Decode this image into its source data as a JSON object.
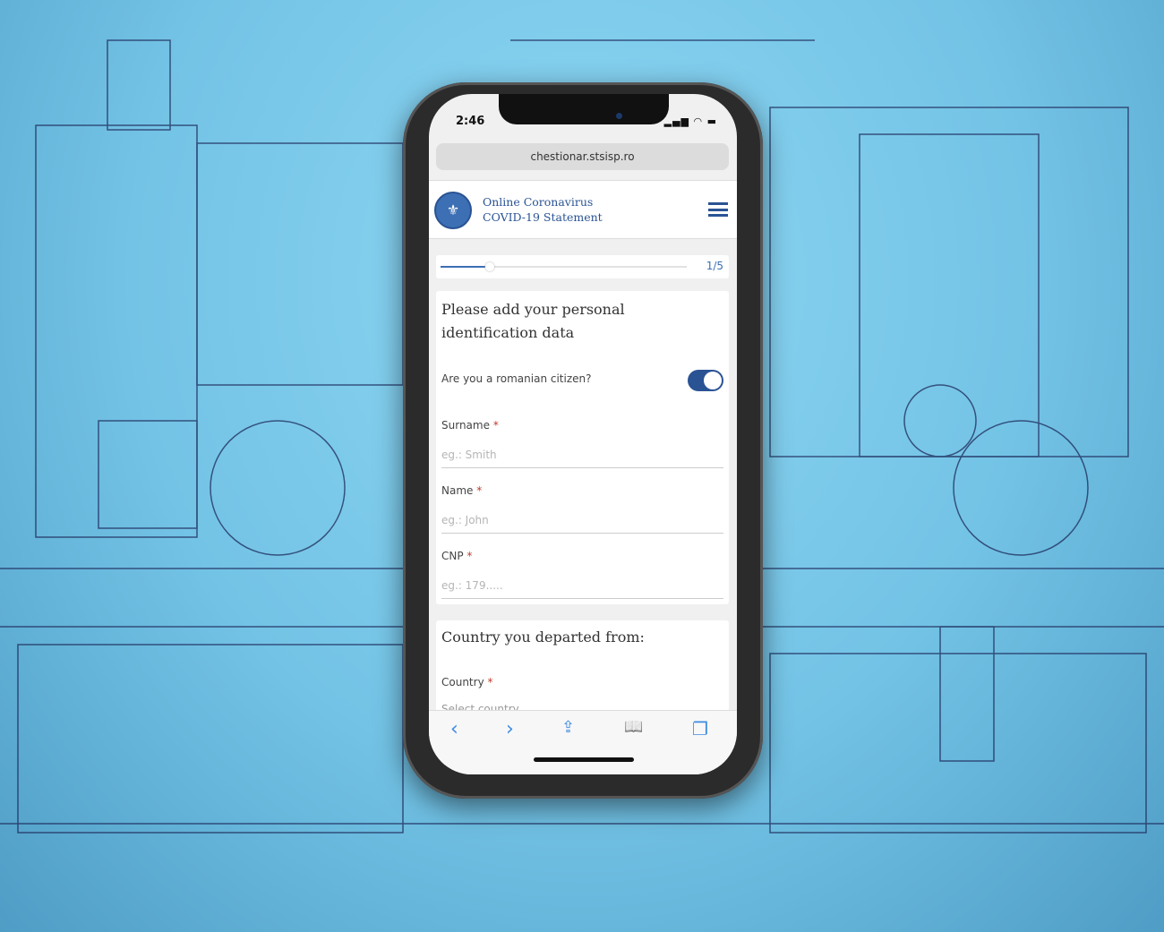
{
  "status_bar": {
    "time": "2:46",
    "icons": "signal wifi battery"
  },
  "browser": {
    "url": "chestionar.stsisp.ro",
    "toolbar": [
      {
        "icon": "back-icon",
        "glyph": "‹"
      },
      {
        "icon": "forward-icon",
        "glyph": "›"
      },
      {
        "icon": "share-icon",
        "glyph": "⇪"
      },
      {
        "icon": "bookmarks-icon",
        "glyph": "📖"
      },
      {
        "icon": "tabs-icon",
        "glyph": "❐"
      }
    ]
  },
  "header": {
    "title_line1": "Online Coronavirus",
    "title_line2": "COVID-19 Statement",
    "logo_glyph": "⚜"
  },
  "progress": {
    "label": "1/5",
    "value": 0.2
  },
  "section1": {
    "heading": "Please add your personal identification data",
    "citizen_label": "Are you a romanian citizen?",
    "citizen_value": true,
    "fields": [
      {
        "label": "Surname",
        "required": "*",
        "placeholder": "eg.: Smith"
      },
      {
        "label": "Name",
        "required": "*",
        "placeholder": "eg.: John"
      },
      {
        "label": "CNP",
        "required": "*",
        "placeholder": "eg.: 179....."
      }
    ]
  },
  "section2": {
    "heading": "Country you departed from:",
    "field": {
      "label": "Country",
      "required": "*",
      "placeholder": "Select country"
    }
  },
  "colors": {
    "accent": "#2a5394",
    "link": "#3d8be0",
    "required": "#c0392b"
  }
}
